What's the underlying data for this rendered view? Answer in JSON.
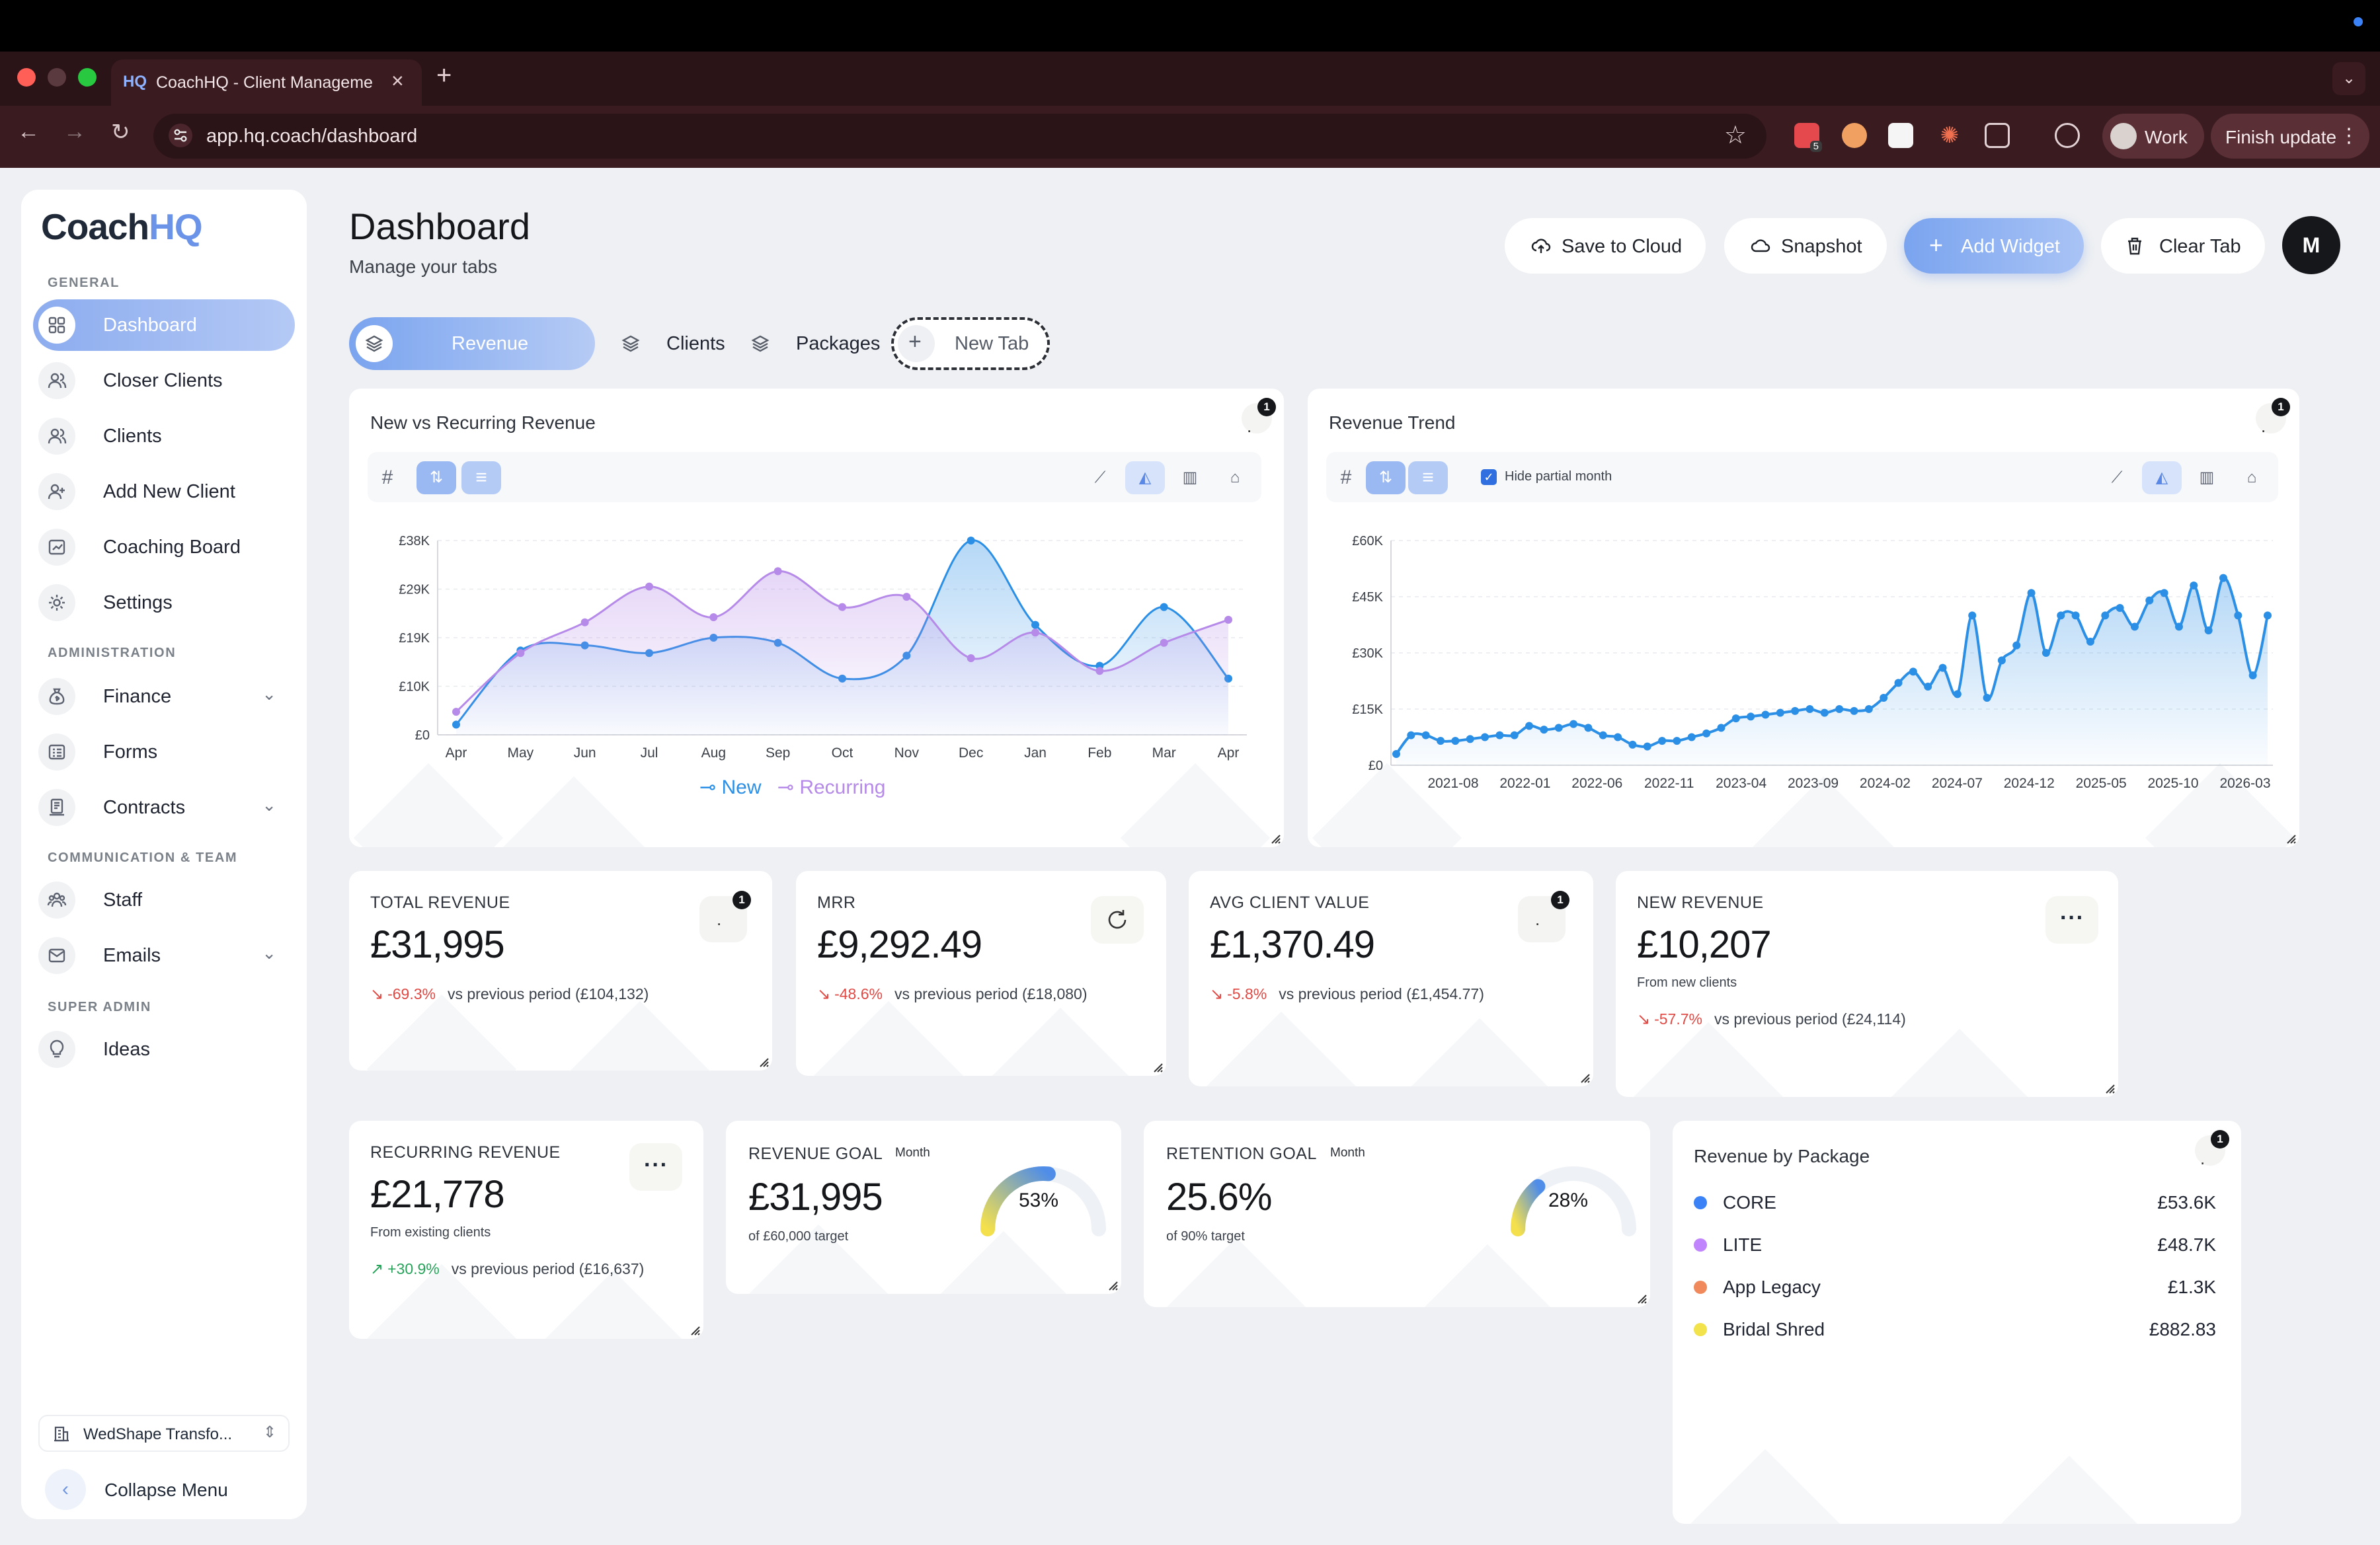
{
  "browser": {
    "tab_favicon": "HQ",
    "tab_title": "CoachHQ - Client Manageme",
    "url": "app.hq.coach/dashboard",
    "ext_badge": "5",
    "profile_label": "Work",
    "update_label": "Finish update"
  },
  "sidebar": {
    "logo_a": "Coach",
    "logo_b": "HQ",
    "sections": {
      "general": "GENERAL",
      "administration": "ADMINISTRATION",
      "communication": "COMMUNICATION & TEAM",
      "super_admin": "SUPER ADMIN"
    },
    "items": [
      {
        "label": "Dashboard",
        "icon": "dashboard-icon"
      },
      {
        "label": "Closer Clients",
        "icon": "users-icon"
      },
      {
        "label": "Clients",
        "icon": "users-icon"
      },
      {
        "label": "Add New Client",
        "icon": "user-plus-icon"
      },
      {
        "label": "Coaching Board",
        "icon": "board-icon"
      },
      {
        "label": "Settings",
        "icon": "gear-icon"
      },
      {
        "label": "Finance",
        "icon": "money-bag-icon"
      },
      {
        "label": "Forms",
        "icon": "form-icon"
      },
      {
        "label": "Contracts",
        "icon": "contract-icon"
      },
      {
        "label": "Staff",
        "icon": "team-icon"
      },
      {
        "label": "Emails",
        "icon": "mail-icon"
      },
      {
        "label": "Ideas",
        "icon": "lightbulb-icon"
      }
    ],
    "org_name": "WedShape Transfo...",
    "collapse_label": "Collapse Menu"
  },
  "header": {
    "title": "Dashboard",
    "subtitle": "Manage your tabs",
    "save_label": "Save to Cloud",
    "snapshot_label": "Snapshot",
    "add_widget_label": "Add Widget",
    "clear_tab_label": "Clear Tab",
    "avatar_initial": "M"
  },
  "tabs": [
    {
      "label": "Revenue"
    },
    {
      "label": "Clients"
    },
    {
      "label": "Packages"
    },
    {
      "label": "New Tab"
    }
  ],
  "widgets": {
    "nvr": {
      "title": "New vs Recurring Revenue",
      "badge": "1"
    },
    "trend": {
      "title": "Revenue Trend",
      "badge": "1",
      "hide_partial": "Hide partial month"
    },
    "total": {
      "label": "TOTAL REVENUE",
      "value": "£31,995",
      "change": "-69.3%",
      "compare": "vs previous period (£104,132)",
      "badge": "1"
    },
    "mrr": {
      "label": "MRR",
      "value": "£9,292.49",
      "change": "-48.6%",
      "compare": "vs previous period (£18,080)"
    },
    "avg": {
      "label": "AVG CLIENT VALUE",
      "value": "£1,370.49",
      "change": "-5.8%",
      "compare": "vs previous period (£1,454.77)",
      "badge": "1"
    },
    "newrev": {
      "label": "NEW REVENUE",
      "value": "£10,207",
      "sub": "From new clients",
      "change": "-57.7%",
      "compare": "vs previous period (£24,114)"
    },
    "recurring": {
      "label": "RECURRING REVENUE",
      "value": "£21,778",
      "sub": "From existing clients",
      "change": "+30.9%",
      "compare": "vs previous period (£16,637)"
    },
    "revgoal": {
      "label": "REVENUE GOAL",
      "period": "Month",
      "value": "£31,995",
      "sub": "of £60,000 target",
      "percent_label": "53%",
      "percent": 53
    },
    "retgoal": {
      "label": "RETENTION GOAL",
      "period": "Month",
      "value": "25.6%",
      "sub": "of 90% target",
      "percent_label": "28%",
      "percent": 28
    },
    "bypackage": {
      "title": "Revenue by Package",
      "badge": "1",
      "rows": [
        {
          "name": "CORE",
          "value": "£53.6K",
          "color": "#3b82f6"
        },
        {
          "name": "LITE",
          "value": "£48.7K",
          "color": "#c084fc"
        },
        {
          "name": "App Legacy",
          "value": "£1.3K",
          "color": "#f08a5d"
        },
        {
          "name": "Bridal Shred",
          "value": "£882.83",
          "color": "#f2e34d"
        }
      ]
    }
  },
  "chart_data": [
    {
      "type": "area",
      "title": "New vs Recurring Revenue",
      "categories": [
        "Apr",
        "May",
        "Jun",
        "Jul",
        "Aug",
        "Sep",
        "Oct",
        "Nov",
        "Dec",
        "Jan",
        "Feb",
        "Mar",
        "Apr"
      ],
      "y_ticks": [
        "£0",
        "£10K",
        "£19K",
        "£29K",
        "£38K"
      ],
      "ylim": [
        0,
        38000
      ],
      "series": [
        {
          "name": "New",
          "color": "#2b8fe6",
          "values": [
            2000,
            16500,
            17500,
            16000,
            19000,
            18000,
            11000,
            15500,
            38000,
            21500,
            13500,
            25000,
            11000
          ]
        },
        {
          "name": "Recurring",
          "color": "#b68ae8",
          "values": [
            4500,
            16000,
            22000,
            29000,
            23000,
            32000,
            25000,
            27000,
            15000,
            20000,
            12500,
            18000,
            22500
          ]
        }
      ],
      "legend": "bottom"
    },
    {
      "type": "area",
      "title": "Revenue Trend",
      "x_ticks": [
        "2021-08",
        "2022-01",
        "2022-06",
        "2022-11",
        "2023-04",
        "2023-09",
        "2024-02",
        "2024-07",
        "2024-12",
        "2025-05",
        "2025-10",
        "2026-03"
      ],
      "y_ticks": [
        "£0",
        "£15K",
        "£30K",
        "£45K",
        "£60K"
      ],
      "ylim": [
        0,
        60000
      ],
      "series": [
        {
          "name": "",
          "color": "#2b8fe6",
          "values": [
            3000,
            8000,
            8000,
            6500,
            6500,
            7000,
            7500,
            8000,
            8000,
            10500,
            9500,
            10000,
            11000,
            10000,
            8000,
            7500,
            5500,
            5000,
            6500,
            6500,
            7500,
            8500,
            10000,
            12500,
            13000,
            13500,
            14000,
            14500,
            15000,
            14000,
            15000,
            14500,
            15000,
            18000,
            22000,
            25000,
            21000,
            26000,
            19000,
            40000,
            18000,
            28000,
            32000,
            46000,
            30000,
            40000,
            40000,
            33000,
            40000,
            42000,
            37000,
            44000,
            46000,
            37000,
            48000,
            36000,
            50000,
            40000,
            24000,
            40000
          ]
        }
      ]
    }
  ]
}
